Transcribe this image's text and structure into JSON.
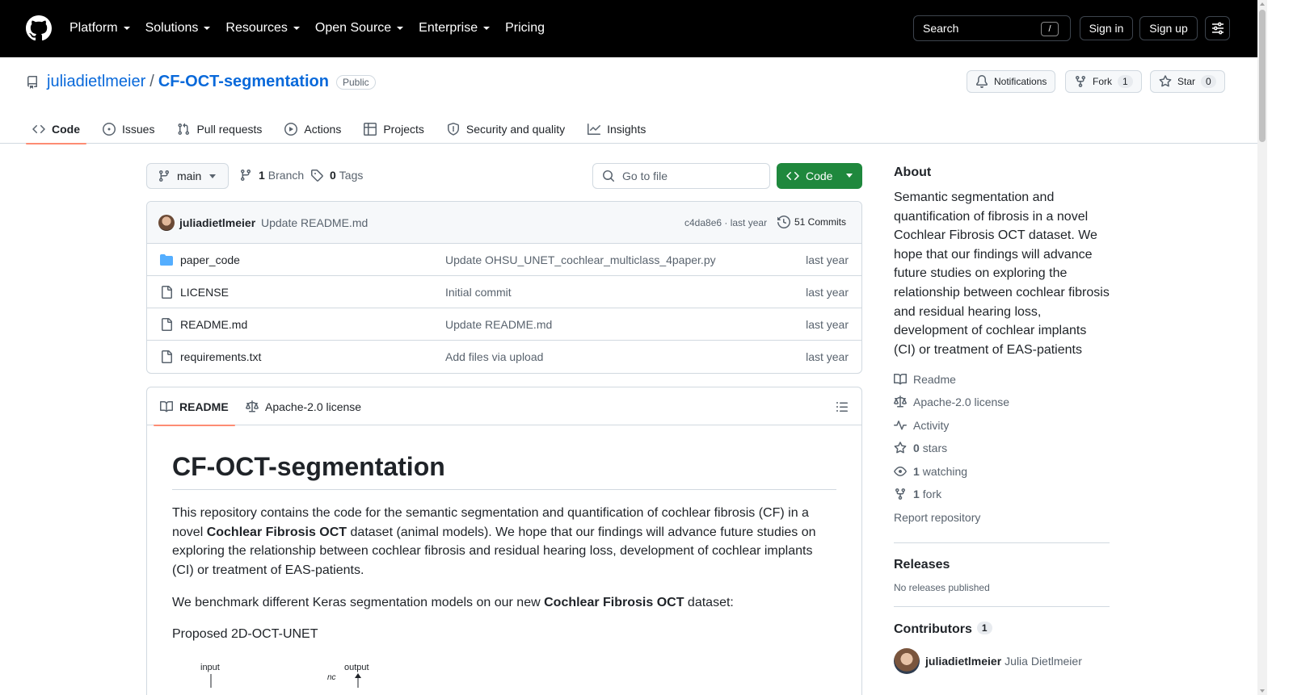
{
  "header": {
    "nav": [
      "Platform",
      "Solutions",
      "Resources",
      "Open Source",
      "Enterprise",
      "Pricing"
    ],
    "search_label": "Search",
    "search_key": "/",
    "signin": "Sign in",
    "signup": "Sign up"
  },
  "repo": {
    "owner": "juliadietlmeier",
    "separator": "/",
    "name": "CF-OCT-segmentation",
    "visibility": "Public",
    "notifications": "Notifications",
    "fork_label": "Fork",
    "fork_count": "1",
    "star_label": "Star",
    "star_count": "0"
  },
  "tabs": [
    "Code",
    "Issues",
    "Pull requests",
    "Actions",
    "Projects",
    "Security and quality",
    "Insights"
  ],
  "browser": {
    "branch": "main",
    "branch_count": "1",
    "branch_label": "Branch",
    "tag_count": "0",
    "tag_label": "Tags",
    "goto_placeholder": "Go to file",
    "code_button": "Code"
  },
  "commit": {
    "author": "juliadietlmeier",
    "message": "Update README.md",
    "hash_date": "c4da8e6 · last year",
    "commits": "51 Commits"
  },
  "files": [
    {
      "name": "paper_code",
      "type": "folder",
      "message": "Update OHSU_UNET_cochlear_multiclass_4paper.py",
      "date": "last year"
    },
    {
      "name": "LICENSE",
      "type": "file",
      "message": "Initial commit",
      "date": "last year"
    },
    {
      "name": "README.md",
      "type": "file",
      "message": "Update README.md",
      "date": "last year"
    },
    {
      "name": "requirements.txt",
      "type": "file",
      "message": "Add files via upload",
      "date": "last year"
    }
  ],
  "readme": {
    "tab_readme": "README",
    "tab_license": "Apache-2.0 license",
    "title": "CF-OCT-segmentation",
    "p1_a": "This repository contains the code for the semantic segmentation and quantification of cochlear fibrosis (CF) in a novel ",
    "p1_bold": "Cochlear Fibrosis OCT",
    "p1_b": " dataset (animal models). We hope that our findings will advance future studies on exploring the relationship between cochlear fibrosis and residual hearing loss, development of cochlear implants (CI) or treatment of EAS-patients.",
    "p2_a": "We benchmark different Keras segmentation models on our new ",
    "p2_bold": "Cochlear Fibrosis OCT",
    "p2_b": " dataset:",
    "p3": "Proposed 2D-OCT-UNET",
    "diagram_input": "input",
    "diagram_output": "output",
    "diagram_nc": "nc"
  },
  "sidebar": {
    "about_title": "About",
    "about_text": "Semantic segmentation and quantification of fibrosis in a novel Cochlear Fibrosis OCT dataset. We hope that our findings will advance future studies on exploring the relationship between cochlear fibrosis and residual hearing loss, development of cochlear implants (CI) or treatment of EAS-patients",
    "readme": "Readme",
    "license": "Apache-2.0 license",
    "activity": "Activity",
    "stars_count": "0",
    "stars_label": "stars",
    "watching_count": "1",
    "watching_label": "watching",
    "fork_count": "1",
    "fork_label": "fork",
    "report": "Report repository",
    "releases_title": "Releases",
    "no_releases": "No releases published",
    "contributors_title": "Contributors",
    "contributors_count": "1",
    "contributor_login": "juliadietlmeier",
    "contributor_name": "Julia Dietlmeier"
  }
}
